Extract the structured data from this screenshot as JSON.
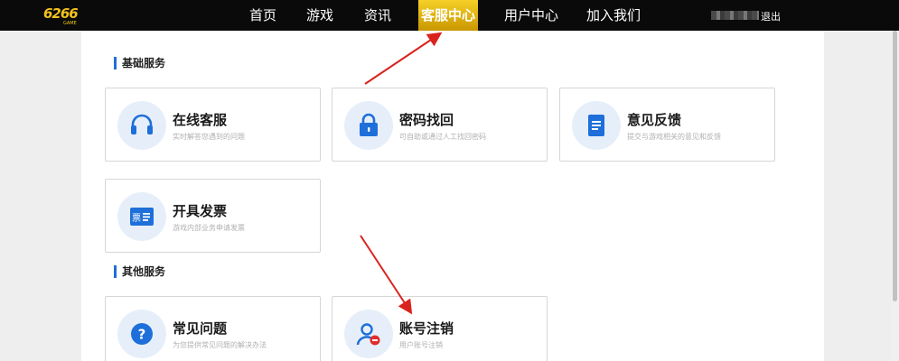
{
  "header": {
    "logo_text": "6266",
    "logo_sub": "GAME",
    "nav": [
      {
        "label": "首页"
      },
      {
        "label": "游戏"
      },
      {
        "label": "资讯"
      },
      {
        "label": "客服中心",
        "active": true
      },
      {
        "label": "用户中心"
      },
      {
        "label": "加入我们"
      }
    ],
    "logout": "退出"
  },
  "sections": [
    {
      "title": "基础服务",
      "cards": [
        {
          "title": "在线客服",
          "desc": "实时解答您遇到的问题",
          "icon": "headset-icon"
        },
        {
          "title": "密码找回",
          "desc": "可自助或通过人工找回密码",
          "icon": "lock-icon"
        },
        {
          "title": "意见反馈",
          "desc": "提交与游戏相关的意见和反馈",
          "icon": "document-icon"
        },
        {
          "title": "开具发票",
          "desc": "游戏内部业务申请发票",
          "icon": "invoice-icon",
          "icon_text": "票"
        }
      ]
    },
    {
      "title": "其他服务",
      "cards": [
        {
          "title": "常见问题",
          "desc": "为您提供常见问题的解决办法",
          "icon": "question-icon",
          "icon_text": "?"
        },
        {
          "title": "账号注销",
          "desc": "用户账号注销",
          "icon": "user-remove-icon"
        }
      ]
    }
  ],
  "colors": {
    "accent": "#1e6fd9",
    "nav_active": "#f5d027",
    "annotation_arrow": "#d9231d"
  }
}
